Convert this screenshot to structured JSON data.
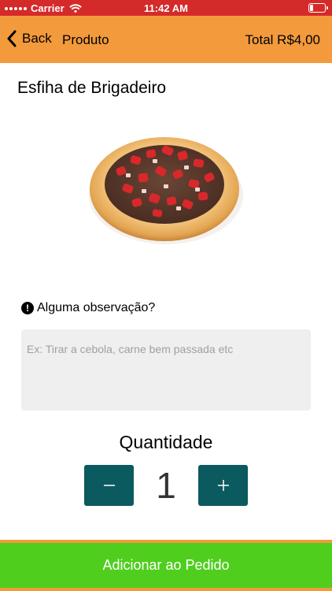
{
  "status_bar": {
    "carrier": "Carrier",
    "time": "11:42 AM"
  },
  "nav": {
    "back_label": "Back",
    "title": "Produto",
    "total": "Total R$4,00"
  },
  "product": {
    "name": "Esfiha de Brigadeiro",
    "image": "esfiha-brigadeiro-photo"
  },
  "observation": {
    "label": "Alguma observação?",
    "placeholder": "Ex: Tirar a cebola, carne bem passada etc",
    "value": ""
  },
  "quantity": {
    "label": "Quantidade",
    "value": "1",
    "minus_symbol": "−",
    "plus_symbol": "+"
  },
  "actions": {
    "add_label": "Adicionar ao Pedido"
  },
  "colors": {
    "status_bar": "#d42a2a",
    "nav_bar": "#f39a3c",
    "qty_button": "#0b5a5f",
    "add_button": "#4fce1e"
  }
}
